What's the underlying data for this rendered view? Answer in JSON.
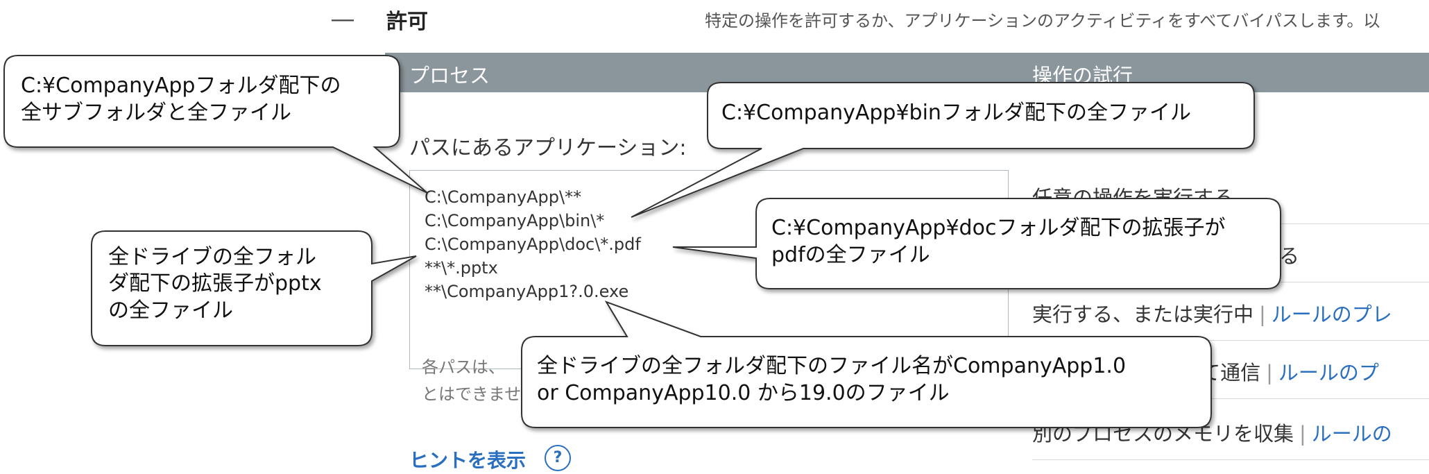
{
  "section": {
    "collapse_symbol": "―",
    "title": "許可",
    "description": "特定の操作を許可するか、アプリケーションのアクティビティをすべてバイパスします。以"
  },
  "table_header": {
    "process": "プロセス",
    "attempted_ops": "操作の試行"
  },
  "path_label": "パスにあるアプリケーション:",
  "paths": [
    "C:\\CompanyApp\\**",
    "C:\\CompanyApp\\bin\\*",
    "C:\\CompanyApp\\doc\\*.pdf",
    "**\\*.pptx",
    "**\\CompanyApp1?.0.exe"
  ],
  "hint_partial": {
    "line1": "各パスは、",
    "line2": "とはできませ"
  },
  "show_hint": "ヒントを表示",
  "help_symbol": "?",
  "operations": [
    {
      "label": "任意の操作を実行する",
      "link": ""
    },
    {
      "label": "る",
      "link": ""
    },
    {
      "label": "実行する、または実行中",
      "link": "ルールのプレ"
    },
    {
      "label": "して通信",
      "link": "ルールのプ"
    },
    {
      "label": "別のプロセスのメモリを収集",
      "link": "ルールの"
    }
  ],
  "callouts": {
    "all_subfolders": [
      "C:¥CompanyAppフォルダ配下の",
      "全サブフォルダと全ファイル"
    ],
    "bin_files": [
      "C:¥CompanyApp¥binフォルダ配下の全ファイル"
    ],
    "doc_pdf": [
      "C:¥CompanyApp¥docフォルダ配下の拡張子が",
      "pdfの全ファイル"
    ],
    "pptx": [
      "全ドライブの全フォル",
      "ダ配下の拡張子がpptx",
      "の全ファイル"
    ],
    "companyapp_exe": [
      "全ドライブの全フォルダ配下のファイル名がCompanyApp1.0",
      "or CompanyApp10.0 から19.0のファイル"
    ]
  },
  "colors": {
    "header_bar": "#8a969c",
    "link": "#2a6fbf",
    "callout_fill": "#ffffff",
    "callout_stroke": "#333333"
  }
}
